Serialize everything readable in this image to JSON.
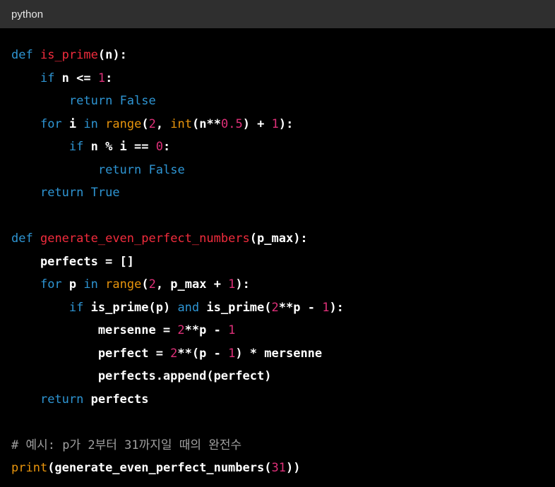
{
  "header": {
    "language": "python"
  },
  "colors": {
    "background": "#000000",
    "header_bar": "#2f2f2f",
    "keyword": "#2e95d3",
    "function_name": "#f22c3d",
    "builtin": "#e9950c",
    "number": "#df3079",
    "comment": "#a0a0a0",
    "text": "#ffffff"
  },
  "code": {
    "lines": [
      [
        [
          "kw",
          "def"
        ],
        [
          "pl",
          " "
        ],
        [
          "fn",
          "is_prime"
        ],
        [
          "pl",
          "(n):"
        ]
      ],
      [
        [
          "pl",
          "    "
        ],
        [
          "kw",
          "if"
        ],
        [
          "pl",
          " n <= "
        ],
        [
          "num",
          "1"
        ],
        [
          "pl",
          ":"
        ]
      ],
      [
        [
          "pl",
          "        "
        ],
        [
          "kw",
          "return"
        ],
        [
          "pl",
          " "
        ],
        [
          "kw",
          "False"
        ]
      ],
      [
        [
          "pl",
          "    "
        ],
        [
          "kw",
          "for"
        ],
        [
          "pl",
          " i "
        ],
        [
          "kw",
          "in"
        ],
        [
          "pl",
          " "
        ],
        [
          "bi",
          "range"
        ],
        [
          "pl",
          "("
        ],
        [
          "num",
          "2"
        ],
        [
          "pl",
          ", "
        ],
        [
          "bi",
          "int"
        ],
        [
          "pl",
          "(n**"
        ],
        [
          "num",
          "0.5"
        ],
        [
          "pl",
          ") + "
        ],
        [
          "num",
          "1"
        ],
        [
          "pl",
          "):"
        ]
      ],
      [
        [
          "pl",
          "        "
        ],
        [
          "kw",
          "if"
        ],
        [
          "pl",
          " n % i == "
        ],
        [
          "num",
          "0"
        ],
        [
          "pl",
          ":"
        ]
      ],
      [
        [
          "pl",
          "            "
        ],
        [
          "kw",
          "return"
        ],
        [
          "pl",
          " "
        ],
        [
          "kw",
          "False"
        ]
      ],
      [
        [
          "pl",
          "    "
        ],
        [
          "kw",
          "return"
        ],
        [
          "pl",
          " "
        ],
        [
          "kw",
          "True"
        ]
      ],
      [],
      [
        [
          "kw",
          "def"
        ],
        [
          "pl",
          " "
        ],
        [
          "fn",
          "generate_even_perfect_numbers"
        ],
        [
          "pl",
          "(p_max):"
        ]
      ],
      [
        [
          "pl",
          "    perfects = []"
        ]
      ],
      [
        [
          "pl",
          "    "
        ],
        [
          "kw",
          "for"
        ],
        [
          "pl",
          " p "
        ],
        [
          "kw",
          "in"
        ],
        [
          "pl",
          " "
        ],
        [
          "bi",
          "range"
        ],
        [
          "pl",
          "("
        ],
        [
          "num",
          "2"
        ],
        [
          "pl",
          ", p_max + "
        ],
        [
          "num",
          "1"
        ],
        [
          "pl",
          "):"
        ]
      ],
      [
        [
          "pl",
          "        "
        ],
        [
          "kw",
          "if"
        ],
        [
          "pl",
          " is_prime(p) "
        ],
        [
          "kw",
          "and"
        ],
        [
          "pl",
          " is_prime("
        ],
        [
          "num",
          "2"
        ],
        [
          "pl",
          "**p - "
        ],
        [
          "num",
          "1"
        ],
        [
          "pl",
          "):"
        ]
      ],
      [
        [
          "pl",
          "            mersenne = "
        ],
        [
          "num",
          "2"
        ],
        [
          "pl",
          "**p - "
        ],
        [
          "num",
          "1"
        ]
      ],
      [
        [
          "pl",
          "            perfect = "
        ],
        [
          "num",
          "2"
        ],
        [
          "pl",
          "**(p - "
        ],
        [
          "num",
          "1"
        ],
        [
          "pl",
          ") * mersenne"
        ]
      ],
      [
        [
          "pl",
          "            perfects.append(perfect)"
        ]
      ],
      [
        [
          "pl",
          "    "
        ],
        [
          "kw",
          "return"
        ],
        [
          "pl",
          " perfects"
        ]
      ],
      [],
      [
        [
          "cm",
          "# 예시: p가 2부터 31까지일 때의 완전수"
        ]
      ],
      [
        [
          "bi",
          "print"
        ],
        [
          "pl",
          "(generate_even_perfect_numbers("
        ],
        [
          "num",
          "31"
        ],
        [
          "pl",
          "))"
        ]
      ]
    ]
  }
}
